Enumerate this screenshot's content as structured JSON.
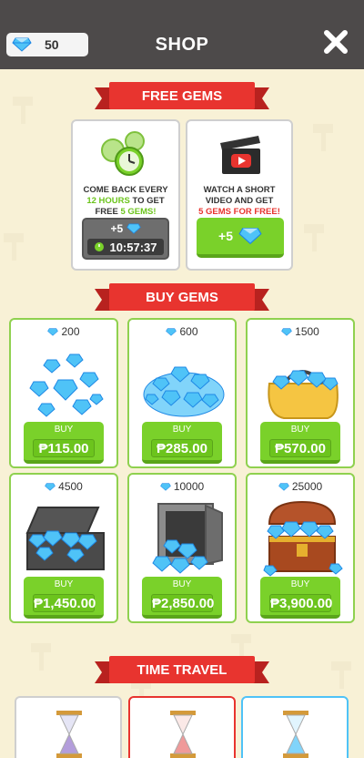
{
  "header": {
    "title": "SHOP",
    "gem_count": "50"
  },
  "free_gems": {
    "title": "FREE GEMS",
    "come_back": {
      "line1": "COME BACK EVERY",
      "line2_highlight": "12 HOURS",
      "line2_rest": " TO GET",
      "line3_prefix": "FREE ",
      "line3_highlight": "5 GEMS!",
      "reward": "+5",
      "timer": "10:57:37"
    },
    "watch_video": {
      "line1": "WATCH A SHORT",
      "line2": "VIDEO AND GET",
      "line3_highlight": "5 GEMS FOR FREE!",
      "button_label": "+5"
    }
  },
  "buy_gems": {
    "title": "BUY GEMS",
    "buy_label": "BUY",
    "packs": [
      {
        "amount": "200",
        "price": "₱115.00"
      },
      {
        "amount": "600",
        "price": "₱285.00"
      },
      {
        "amount": "1500",
        "price": "₱570.00"
      },
      {
        "amount": "4500",
        "price": "₱1,450.00"
      },
      {
        "amount": "10000",
        "price": "₱2,850.00"
      },
      {
        "amount": "25000",
        "price": "₱3,900.00"
      }
    ]
  },
  "time_travel": {
    "title": "TIME TRAVEL"
  },
  "colors": {
    "accent_green": "#7ad12a",
    "ribbon_red": "#e8342f",
    "header_dark": "#4d4a4a",
    "background": "#f8f1d6"
  }
}
